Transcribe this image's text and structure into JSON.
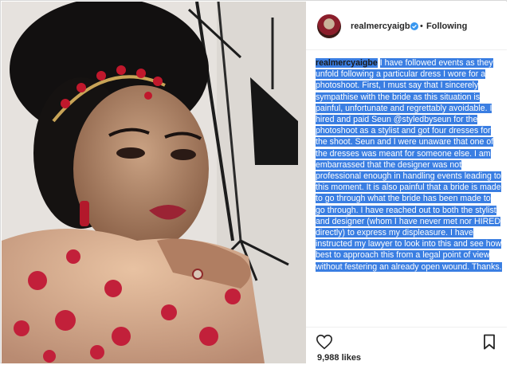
{
  "post": {
    "username": "realmercyaigbe",
    "separator": "•",
    "follow_status": "Following",
    "caption_user": "realmercyaigbe",
    "caption_text": "I have followed events as they unfold following a particular dress I wore for a photoshoot. First, I must say that I sincerely sympathise with the bride as this situation is painful, unfortunate and regrettably avoidable. I hired and paid Seun @styledbyseun for the photoshoot as a stylist and got four dresses for the shoot. Seun and I were unaware that one of the dresses was meant for someone else. I am embarrassed that the designer was not professional enough in handling events leading to this moment. It is also painful that a bride is made to go through what the bride has been made to go through. I have reached out to both the stylist and designer (whom I have never met nor HIRED directly) to express my displeasure. I have instructed my lawyer to look into this and see how best to approach this from a legal point of view without festering an already open wound. Thanks.",
    "likes": "9,988 likes"
  },
  "icons": {
    "heart": "heart-icon",
    "bookmark": "bookmark-icon",
    "verified": "verified-badge-icon"
  },
  "colors": {
    "selection_highlight": "#3a7ee2",
    "verified_blue": "#3897f0",
    "text_dark": "#262626"
  }
}
